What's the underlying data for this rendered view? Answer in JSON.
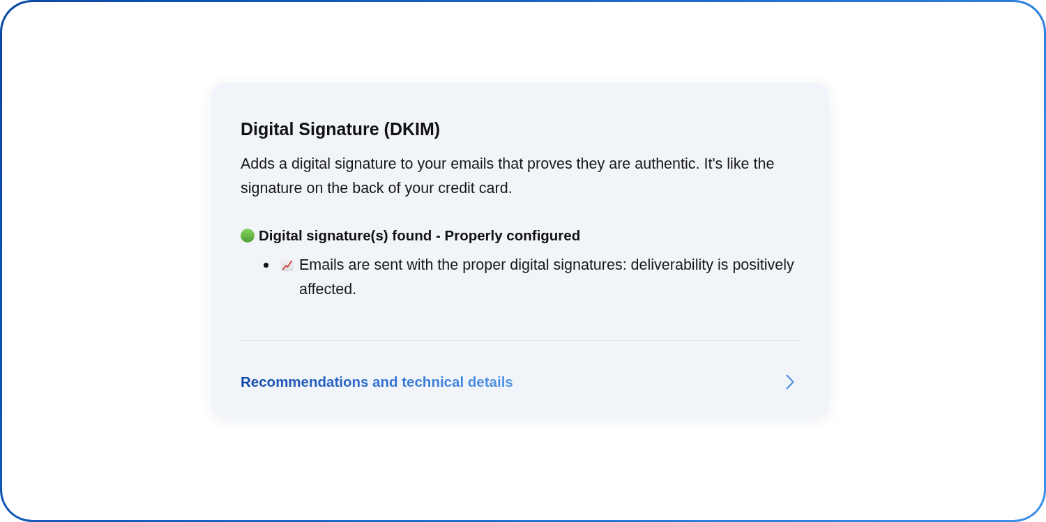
{
  "card": {
    "title": "Digital Signature (DKIM)",
    "description": "Adds a digital signature to your emails that proves they are authentic. It's like the signature on the back of your credit card.",
    "status": {
      "passed": true,
      "label": "Digital signature(s) found - Properly configured"
    },
    "points": [
      {
        "kind": "trend-up",
        "text": "Emails are sent with the proper digital signatures: deliverability is positively affected."
      }
    ],
    "link": {
      "label": "Recommendations and technical details"
    }
  }
}
